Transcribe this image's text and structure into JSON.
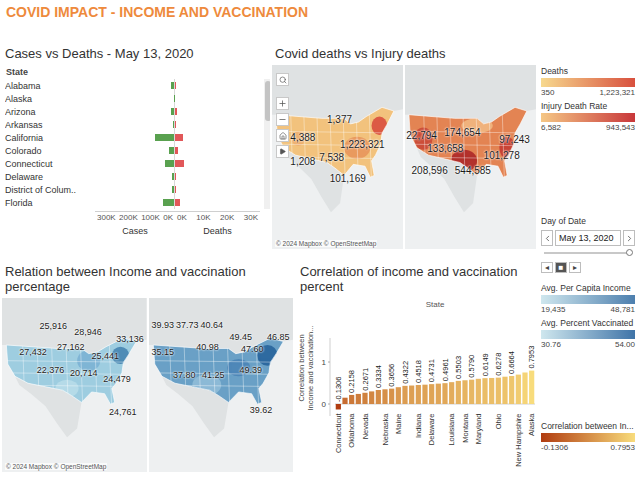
{
  "title": "COVID IMPACT - INCOME AND VACCINATION",
  "cases_panel": {
    "title": "Cases vs Deaths - May 13, 2020",
    "column": "State",
    "scroll": 0,
    "rows": [
      {
        "state": "Alabama",
        "cases": 10700,
        "deaths": 450
      },
      {
        "state": "Alaska",
        "cases": 383,
        "deaths": 10
      },
      {
        "state": "Arizona",
        "cases": 12176,
        "deaths": 594
      },
      {
        "state": "Arkansas",
        "cases": 4366,
        "deaths": 98
      },
      {
        "state": "California",
        "cases": 71141,
        "deaths": 2934
      },
      {
        "state": "Colorado",
        "cases": 20157,
        "deaths": 1009
      },
      {
        "state": "Connecticut",
        "cases": 34333,
        "deaths": 3041
      },
      {
        "state": "Delaware",
        "cases": 6741,
        "deaths": 241
      },
      {
        "state": "District of Colum..",
        "cases": 6584,
        "deaths": 350
      },
      {
        "state": "Florida",
        "cases": 42402,
        "deaths": 1827
      }
    ],
    "cases_axis": {
      "title": "Cases",
      "max": 300000,
      "ticks": [
        "300K",
        "200K",
        "100K",
        "0K"
      ]
    },
    "deaths_axis": {
      "title": "Deaths",
      "max": 30000,
      "ticks": [
        "0K",
        "10K",
        "20K",
        "30K"
      ]
    }
  },
  "deaths_maps": {
    "title": "Covid deaths vs Injury deaths",
    "attribution": "© 2024 Mapbox © OpenStreetMap",
    "maps": [
      {
        "labels": [
          "4,388",
          "1,377",
          "1,223,321",
          "1,208",
          "7,538",
          "101,169"
        ]
      },
      {
        "labels": [
          "22,794",
          "174,654",
          "133,658",
          "97,243",
          "101,278",
          "208,596",
          "544,585"
        ]
      }
    ]
  },
  "income_maps": {
    "title": "Relation between Income and vaccination percentage",
    "attribution": "© 2024 Mapbox © OpenStreetMap",
    "maps": [
      {
        "labels": [
          "25,916",
          "28,946",
          "27,432",
          "27,162",
          "25,441",
          "33,136",
          "22,376",
          "20,714",
          "24,479",
          "24,761"
        ]
      },
      {
        "labels": [
          "39.93",
          "37.73",
          "40.64",
          "49.45",
          "35.15",
          "40.98",
          "47.60",
          "46.85",
          "37.80",
          "41.25",
          "49.39",
          "39.62"
        ]
      }
    ]
  },
  "correlation_chart": {
    "title": "Correlation of income and vaccination percent",
    "column": "State",
    "y_axis": {
      "title": [
        "Correlation between",
        "Income and vaccination..."
      ],
      "ticks": [
        "1",
        "0"
      ]
    },
    "bars": [
      {
        "value": -0.1306,
        "label": "-0.1306",
        "state": "Connecticut"
      },
      {
        "value": 0.15
      },
      {
        "value": 0.2158,
        "label": "0.2158",
        "state": "Oklahoma"
      },
      {
        "value": 0.24
      },
      {
        "value": 0.2671,
        "label": "0.2671",
        "state": "Nevada"
      },
      {
        "value": 0.3
      },
      {
        "value": 0.3334,
        "label": "0.3334"
      },
      {
        "value": 0.35,
        "state": "Nebraska"
      },
      {
        "value": 0.3656,
        "label": "0.3656"
      },
      {
        "value": 0.4,
        "state": "Maine"
      },
      {
        "value": 0.4322,
        "label": "0.4322"
      },
      {
        "value": 0.44
      },
      {
        "value": 0.4518,
        "label": "0.4518",
        "state": "Indiana"
      },
      {
        "value": 0.46
      },
      {
        "value": 0.4731,
        "label": "0.4731",
        "state": "Delaware"
      },
      {
        "value": 0.485
      },
      {
        "value": 0.4961,
        "label": "0.4961"
      },
      {
        "value": 0.52,
        "state": "Louisiana"
      },
      {
        "value": 0.5503,
        "label": "0.5503"
      },
      {
        "value": 0.565,
        "state": "Montana"
      },
      {
        "value": 0.579,
        "label": "0.5790"
      },
      {
        "value": 0.6,
        "state": "Maryland"
      },
      {
        "value": 0.6149,
        "label": "0.6149"
      },
      {
        "value": 0.62
      },
      {
        "value": 0.6278,
        "label": "0.6278",
        "state": "Ohio"
      },
      {
        "value": 0.65
      },
      {
        "value": 0.6664,
        "label": "0.6664"
      },
      {
        "value": 0.7,
        "state": "New Hampshire"
      },
      {
        "value": 0.75
      },
      {
        "value": 0.7953,
        "label": "0.7953",
        "state": "Alaska"
      }
    ]
  },
  "legends_top": [
    {
      "title": "Deaths",
      "min": "350",
      "max": "1,223,321",
      "colors": [
        "#f7d98e",
        "#d8503e"
      ]
    },
    {
      "title": "Injury Death Rate",
      "min": "6,582",
      "max": "943,543",
      "colors": [
        "#f5c785",
        "#c8373a"
      ]
    }
  ],
  "date_filter": {
    "label": "Day of Date",
    "value": "May 13, 2020",
    "level": 0.97
  },
  "playback": [
    {
      "glyph": "◂",
      "selected": false
    },
    {
      "glyph": "■",
      "selected": true
    },
    {
      "glyph": "▸",
      "selected": false
    }
  ],
  "legends_bottom": [
    {
      "title": "Avg. Per Capita Income",
      "min": "19,435",
      "max": "48,781",
      "colors": [
        "#cfe7ee",
        "#4d7fae"
      ]
    },
    {
      "title": "Avg. Percent Vaccinated",
      "min": "30.76",
      "max": "54.00",
      "colors": [
        "#cfe7ee",
        "#3f74a8"
      ]
    },
    {
      "title": "Correlation between In...",
      "min": "-0.1306",
      "max": "0.7953",
      "colors": [
        "#b13c10",
        "#f8dc7c"
      ]
    }
  ]
}
